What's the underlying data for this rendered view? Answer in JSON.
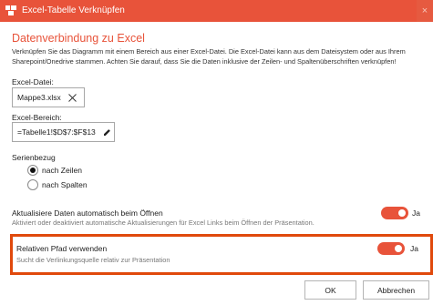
{
  "window": {
    "title": "Excel-Tabelle Verknüpfen",
    "close_glyph": "×"
  },
  "header": {
    "heading": "Datenverbindung zu Excel",
    "description": "Verknüpfen Sie das Diagramm mit einem Bereich aus einer Excel-Datei. Die Excel-Datei kann aus dem Dateisystem oder aus Ihrem Sharepoint/Onedrive stammen. Achten Sie darauf, dass Sie die Daten inklusive der Zeilen- und Spaltenüberschriften verknüpfen!"
  },
  "excel_file": {
    "label": "Excel-Datei:",
    "value": "Mappe3.xlsx",
    "clear_icon": "close-icon"
  },
  "excel_range": {
    "label": "Excel-Bereich:",
    "value": "=Tabelle1!$D$7:$F$13",
    "edit_icon": "pencil-icon"
  },
  "series": {
    "label": "Serienbezug",
    "options": [
      {
        "label": "nach Zeilen",
        "checked": true
      },
      {
        "label": "nach Spalten",
        "checked": false
      }
    ]
  },
  "auto_update": {
    "label": "Aktualisiere Daten automatisch beim Öffnen",
    "description": "Aktiviert oder deaktiviert automatische Aktualisierungen für Excel Links beim Öffnen der Präsentation.",
    "state_label": "Ja",
    "enabled": true
  },
  "relative_path": {
    "label": "Relativen Pfad verwenden",
    "description": "Sucht die Verlinkungsquelle relativ zur Präsentation",
    "state_label": "Ja",
    "enabled": true
  },
  "buttons": {
    "ok": "OK",
    "cancel": "Abbrechen"
  },
  "colors": {
    "accent": "#e8533a",
    "highlight_border": "#e0490c"
  }
}
